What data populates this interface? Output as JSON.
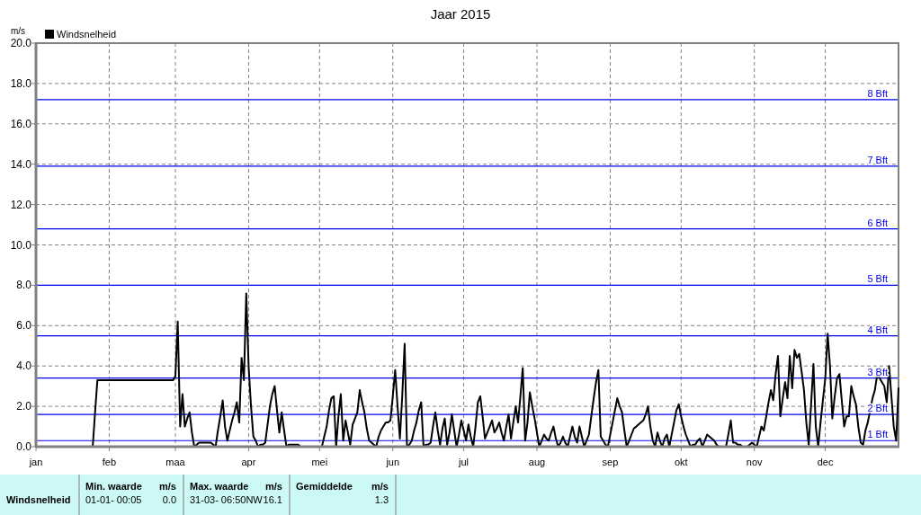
{
  "chart": {
    "chart_data": {
      "type": "line",
      "title": "Jaar 2015",
      "ylabel": "m/s",
      "grid": true,
      "categories": [
        "jan",
        null,
        null,
        null,
        null,
        null,
        null,
        null,
        null,
        null,
        null,
        null,
        null,
        null,
        null,
        null,
        null,
        null,
        null,
        null,
        null,
        null,
        null,
        null,
        null,
        null,
        null,
        null,
        null,
        null,
        null,
        "feb",
        null,
        null,
        null,
        null,
        null,
        null,
        null,
        null,
        null,
        null,
        null,
        null,
        null,
        null,
        null,
        null,
        null,
        null,
        null,
        null,
        null,
        null,
        null,
        null,
        null,
        null,
        null,
        "maa",
        null,
        null,
        null,
        null,
        null,
        null,
        null,
        null,
        null,
        null,
        null,
        null,
        null,
        null,
        null,
        null,
        null,
        null,
        null,
        null,
        null,
        null,
        null,
        null,
        null,
        null,
        null,
        null,
        null,
        null,
        "apr",
        null,
        null,
        null,
        null,
        null,
        null,
        null,
        null,
        null,
        null,
        null,
        null,
        null,
        null,
        null,
        null,
        null,
        null,
        null,
        null,
        null,
        null,
        null,
        null,
        null,
        null,
        null,
        null,
        null,
        "mei",
        null,
        null,
        null,
        null,
        null,
        null,
        null,
        null,
        null,
        null,
        null,
        null,
        null,
        null,
        null,
        null,
        null,
        null,
        null,
        null,
        null,
        null,
        null,
        null,
        null,
        null,
        null,
        null,
        null,
        null,
        "jun",
        null,
        null,
        null,
        null,
        null,
        null,
        null,
        null,
        null,
        null,
        null,
        null,
        null,
        null,
        null,
        null,
        null,
        null,
        null,
        null,
        null,
        null,
        null,
        null,
        null,
        null,
        null,
        null,
        null,
        "jul",
        null,
        null,
        null,
        null,
        null,
        null,
        null,
        null,
        null,
        null,
        null,
        null,
        null,
        null,
        null,
        null,
        null,
        null,
        null,
        null,
        null,
        null,
        null,
        null,
        null,
        null,
        null,
        null,
        null,
        null,
        "aug",
        null,
        null,
        null,
        null,
        null,
        null,
        null,
        null,
        null,
        null,
        null,
        null,
        null,
        null,
        null,
        null,
        null,
        null,
        null,
        null,
        null,
        null,
        null,
        null,
        null,
        null,
        null,
        null,
        null,
        null,
        "sep",
        null,
        null,
        null,
        null,
        null,
        null,
        null,
        null,
        null,
        null,
        null,
        null,
        null,
        null,
        null,
        null,
        null,
        null,
        null,
        null,
        null,
        null,
        null,
        null,
        null,
        null,
        null,
        null,
        null,
        "okt",
        null,
        null,
        null,
        null,
        null,
        null,
        null,
        null,
        null,
        null,
        null,
        null,
        null,
        null,
        null,
        null,
        null,
        null,
        null,
        null,
        null,
        null,
        null,
        null,
        null,
        null,
        null,
        null,
        null,
        null,
        "nov",
        null,
        null,
        null,
        null,
        null,
        null,
        null,
        null,
        null,
        null,
        null,
        null,
        null,
        null,
        null,
        null,
        null,
        null,
        null,
        null,
        null,
        null,
        null,
        null,
        null,
        null,
        null,
        null,
        null,
        "dec",
        null,
        null,
        null,
        null,
        null,
        null,
        null,
        null,
        null,
        null,
        null,
        null,
        null,
        null,
        null,
        null,
        null,
        null,
        null,
        null,
        null,
        null,
        null,
        null,
        null,
        null,
        null,
        null,
        null,
        null,
        null
      ],
      "series": [
        {
          "name": "Windsnelheid",
          "color": "#000000",
          "values": [
            0,
            0,
            0,
            0,
            0,
            0,
            0,
            0,
            0,
            0,
            0,
            0,
            0,
            0,
            0,
            0,
            0,
            0,
            0,
            0,
            0,
            0,
            0,
            0,
            0,
            1.7,
            3.3,
            3.3,
            3.3,
            3.3,
            3.3,
            3.3,
            3.3,
            3.3,
            3.3,
            3.3,
            3.3,
            3.3,
            3.3,
            3.3,
            3.3,
            3.3,
            3.3,
            3.3,
            3.3,
            3.3,
            3.3,
            3.3,
            3.3,
            3.3,
            3.3,
            3.3,
            3.3,
            3.3,
            3.3,
            3.3,
            3.3,
            3.3,
            3.3,
            3.5,
            6.2,
            1.0,
            2.6,
            1.0,
            1.4,
            1.7,
            0.7,
            0.0,
            0.1,
            0.2,
            0.2,
            0.2,
            0.2,
            0.2,
            0.2,
            0.1,
            0.0,
            0.8,
            1.5,
            2.3,
            1.0,
            0.3,
            0.8,
            1.3,
            1.7,
            2.2,
            1.2,
            4.4,
            3.3,
            7.6,
            3.9,
            2.0,
            0.5,
            0.3,
            0.0,
            0.1,
            0.1,
            0.2,
            1.1,
            2.0,
            2.6,
            3.0,
            1.8,
            0.7,
            1.7,
            0.8,
            0.0,
            0.1,
            0.1,
            0.1,
            0.1,
            0.1,
            0,
            0,
            0,
            0,
            0,
            0,
            0,
            0,
            0,
            0,
            0.5,
            1.0,
            1.8,
            2.4,
            2.5,
            0.0,
            1.5,
            2.6,
            0.3,
            1.3,
            0.7,
            0.1,
            1.1,
            1.4,
            1.7,
            2.8,
            2.2,
            1.7,
            0.9,
            0.3,
            0.2,
            0.1,
            0.0,
            0.5,
            0.8,
            1.0,
            1.2,
            1.2,
            1.3,
            2.5,
            3.8,
            2.0,
            0.4,
            2.5,
            5.1,
            0.0,
            0.1,
            0.3,
            0.8,
            1.2,
            1.8,
            2.2,
            0.0,
            0.1,
            0.1,
            0.2,
            1.0,
            1.7,
            0.8,
            0.1,
            0.9,
            1.4,
            0.1,
            0.7,
            1.6,
            0.8,
            0.0,
            0.6,
            1.3,
            0.8,
            0.3,
            1.1,
            0.5,
            0.0,
            1.0,
            2.2,
            2.5,
            1.5,
            0.4,
            0.7,
            1.0,
            1.3,
            0.7,
            0.9,
            1.2,
            0.7,
            0.3,
            1.0,
            1.6,
            0.4,
            1.2,
            2.0,
            1.2,
            2.5,
            3.9,
            0.3,
            1.2,
            2.7,
            2.0,
            1.4,
            0.7,
            0.0,
            0.3,
            0.6,
            0.4,
            0.3,
            0.7,
            1.0,
            0.4,
            0.0,
            0.2,
            0.5,
            0.2,
            0.0,
            0.5,
            1.0,
            0.5,
            0.2,
            1.0,
            0.5,
            0.0,
            0.3,
            0.6,
            1.5,
            2.4,
            3.2,
            3.8,
            0.5,
            0.3,
            0.1,
            0.0,
            0.6,
            1.2,
            1.8,
            2.4,
            2.0,
            1.7,
            0.8,
            0.0,
            0.3,
            0.6,
            0.9,
            1.0,
            1.1,
            1.2,
            1.3,
            1.6,
            2.0,
            1.0,
            0.3,
            0.0,
            0.7,
            0.3,
            0.0,
            0.4,
            0.6,
            0.0,
            0.6,
            1.2,
            1.8,
            2.1,
            1.5,
            1.0,
            0.6,
            0.3,
            0.0,
            0.1,
            0.1,
            0.3,
            0.4,
            0.0,
            0.3,
            0.6,
            0.5,
            0.4,
            0.3,
            0.1,
            0,
            0,
            0,
            0,
            0.6,
            1.3,
            0.2,
            0.2,
            0.1,
            0.1,
            0.0,
            0.0,
            0.0,
            0.1,
            0.2,
            0.1,
            0.0,
            0.5,
            1.0,
            0.8,
            1.5,
            2.2,
            2.8,
            2.3,
            3.6,
            4.5,
            1.5,
            2.4,
            3.2,
            2.4,
            4.5,
            2.9,
            4.8,
            4.4,
            4.6,
            3.7,
            2.8,
            1.2,
            0.1,
            2.1,
            4.1,
            1.0,
            0.0,
            1.2,
            2.3,
            3.4,
            5.6,
            4.0,
            1.4,
            2.5,
            3.4,
            3.6,
            2.3,
            1.0,
            1.5,
            1.5,
            3.0,
            2.5,
            2.1,
            1.0,
            0.2,
            0.1,
            0.8,
            1.2,
            1.8,
            2.4,
            2.8,
            3.6,
            3.4,
            3.2,
            3.0,
            2.2,
            4.0,
            2.5,
            1.0,
            0.3,
            2.9
          ]
        }
      ],
      "ylim": [
        0,
        20
      ],
      "yticks": [
        {
          "value": 0,
          "label": "0.0"
        },
        {
          "value": 2,
          "label": "2.0"
        },
        {
          "value": 4,
          "label": "4.0"
        },
        {
          "value": 6,
          "label": "6.0"
        },
        {
          "value": 8,
          "label": "8.0"
        },
        {
          "value": 10,
          "label": "10.0"
        },
        {
          "value": 12,
          "label": "12.0"
        },
        {
          "value": 14,
          "label": "14.0"
        },
        {
          "value": 16,
          "label": "16.0"
        },
        {
          "value": 18,
          "label": "18.0"
        },
        {
          "value": 20,
          "label": "20.0"
        }
      ],
      "ref_lines": [
        {
          "axis": "y",
          "value": 0.3,
          "label": "1 Bft",
          "color": "#0000ee"
        },
        {
          "axis": "y",
          "value": 1.6,
          "label": "2 Bft",
          "color": "#0000ee"
        },
        {
          "axis": "y",
          "value": 3.4,
          "label": "3 Bft",
          "color": "#0000ee"
        },
        {
          "axis": "y",
          "value": 5.5,
          "label": "4 Bft",
          "color": "#0000ee"
        },
        {
          "axis": "y",
          "value": 8.0,
          "label": "5 Bft",
          "color": "#0000ee"
        },
        {
          "axis": "y",
          "value": 10.8,
          "label": "6 Bft",
          "color": "#0000ee"
        },
        {
          "axis": "y",
          "value": 13.9,
          "label": "7 Bft",
          "color": "#0000ee"
        },
        {
          "axis": "y",
          "value": 17.2,
          "label": "8 Bft",
          "color": "#0000ee"
        }
      ]
    }
  },
  "summary_table": {
    "row_label": "Windsnelheid",
    "columns": [
      {
        "header": "Min. waarde",
        "unit": "m/s",
        "time": "01-01- 00:05",
        "value": "0.0"
      },
      {
        "header": "Max. waarde",
        "unit": "m/s",
        "time": "31-03- 06:50NW",
        "value": "16.1"
      },
      {
        "header": "Gemiddelde",
        "unit": "m/s",
        "value": "1.3"
      }
    ]
  }
}
